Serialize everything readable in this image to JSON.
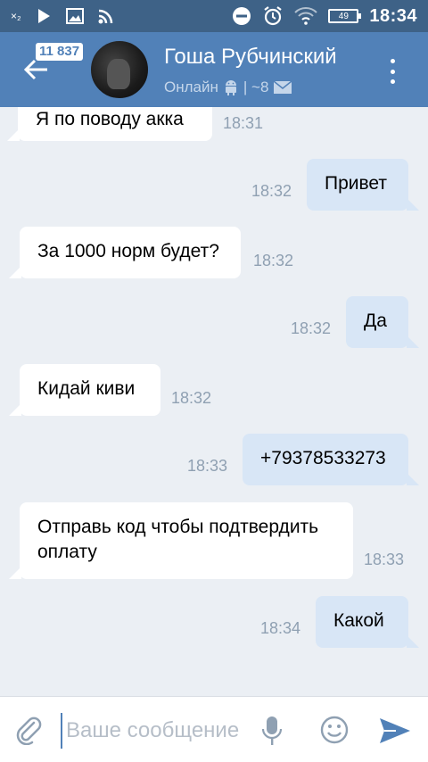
{
  "status_bar": {
    "time": "18:34",
    "battery": "49",
    "left_icons": [
      "x-icon",
      "play-icon",
      "image-icon",
      "cast-icon"
    ],
    "right_icons": [
      "dnd-icon",
      "alarm-icon",
      "wifi-icon",
      "battery-icon"
    ],
    "x_label": "×₂"
  },
  "header": {
    "unread_count": "11 837",
    "contact_name": "Гоша Рубчинский",
    "status_text": "Онлайн",
    "status_extra": "| ~8"
  },
  "messages": [
    {
      "direction": "in",
      "text": "Я по поводу акка",
      "time": "18:31"
    },
    {
      "direction": "out",
      "text": "Привет",
      "time": "18:32"
    },
    {
      "direction": "in",
      "text": "За 1000 норм будет?",
      "time": "18:32"
    },
    {
      "direction": "out",
      "text": "Да",
      "time": "18:32"
    },
    {
      "direction": "in",
      "text": "Кидай киви",
      "time": "18:32"
    },
    {
      "direction": "out",
      "text": "+79378533273",
      "time": "18:33"
    },
    {
      "direction": "in",
      "text": "Отправь код чтобы подтвердить оплату",
      "time": "18:33"
    },
    {
      "direction": "out",
      "text": "Какой",
      "time": "18:34"
    }
  ],
  "input": {
    "placeholder": "Ваше сообщение"
  },
  "colors": {
    "status_bar": "#3e6287",
    "header": "#5181b8",
    "background": "#ebeff4",
    "outgoing_bubble": "#d8e6f6",
    "incoming_bubble": "#ffffff",
    "accent": "#5181b8"
  }
}
